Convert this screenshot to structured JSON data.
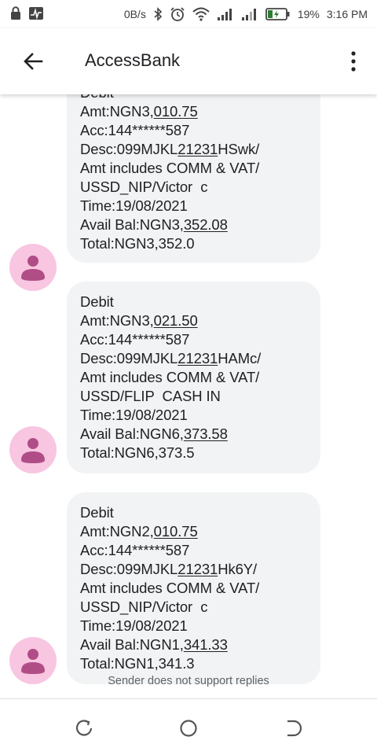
{
  "status_bar": {
    "network_speed": "0B/s",
    "battery_percent": "19%",
    "time": "3:16 PM",
    "icons": [
      "lock-icon",
      "activity-icon",
      "bluetooth-icon",
      "alarm-icon",
      "wifi-icon",
      "signal-icon",
      "signal-icon",
      "battery-charging-icon"
    ]
  },
  "app_bar": {
    "title": "AccessBank",
    "back_icon": "arrow-back-icon",
    "menu_icon": "more-vert-icon"
  },
  "messages": [
    {
      "lines": [
        [
          "Debit"
        ],
        [
          "Amt:NGN3,",
          "010.75"
        ],
        [
          "Acc:144******587"
        ],
        [
          "Desc:099MJKL",
          "21231",
          "HSwk/"
        ],
        [
          "Amt includes COMM & VAT/"
        ],
        [
          "USSD_NIP/Victor  c"
        ],
        [
          "Time:19/08/2021"
        ],
        [
          "Avail Bal:NGN3,",
          "352.08"
        ],
        [
          "Total:NGN3,352.0"
        ]
      ]
    },
    {
      "lines": [
        [
          "Debit"
        ],
        [
          "Amt:NGN3,",
          "021.50"
        ],
        [
          "Acc:144******587"
        ],
        [
          "Desc:099MJKL",
          "21231",
          "HAMc/"
        ],
        [
          "Amt includes COMM & VAT/"
        ],
        [
          "USSD/FLIP  CASH IN"
        ],
        [
          "Time:19/08/2021"
        ],
        [
          "Avail Bal:NGN6,",
          "373.58"
        ],
        [
          "Total:NGN6,373.5"
        ]
      ]
    },
    {
      "lines": [
        [
          "Debit"
        ],
        [
          "Amt:NGN2,",
          "010.75"
        ],
        [
          "Acc:144******587"
        ],
        [
          "Desc:099MJKL",
          "21231",
          "Hk6Y/"
        ],
        [
          "Amt includes COMM & VAT/"
        ],
        [
          "USSD_NIP/Victor  c"
        ],
        [
          "Time:19/08/2021"
        ],
        [
          "Avail Bal:NGN1,",
          "341.33"
        ],
        [
          "Total:NGN1,341.3"
        ]
      ]
    }
  ],
  "footer": {
    "note": "Sender does not support replies"
  },
  "nav_bar": {
    "items": [
      "recents-icon",
      "home-icon",
      "back-icon"
    ]
  },
  "colors": {
    "bubble": "#f1f3f4",
    "avatar_bg": "#f8c6e1",
    "avatar_fg": "#b04d86"
  }
}
